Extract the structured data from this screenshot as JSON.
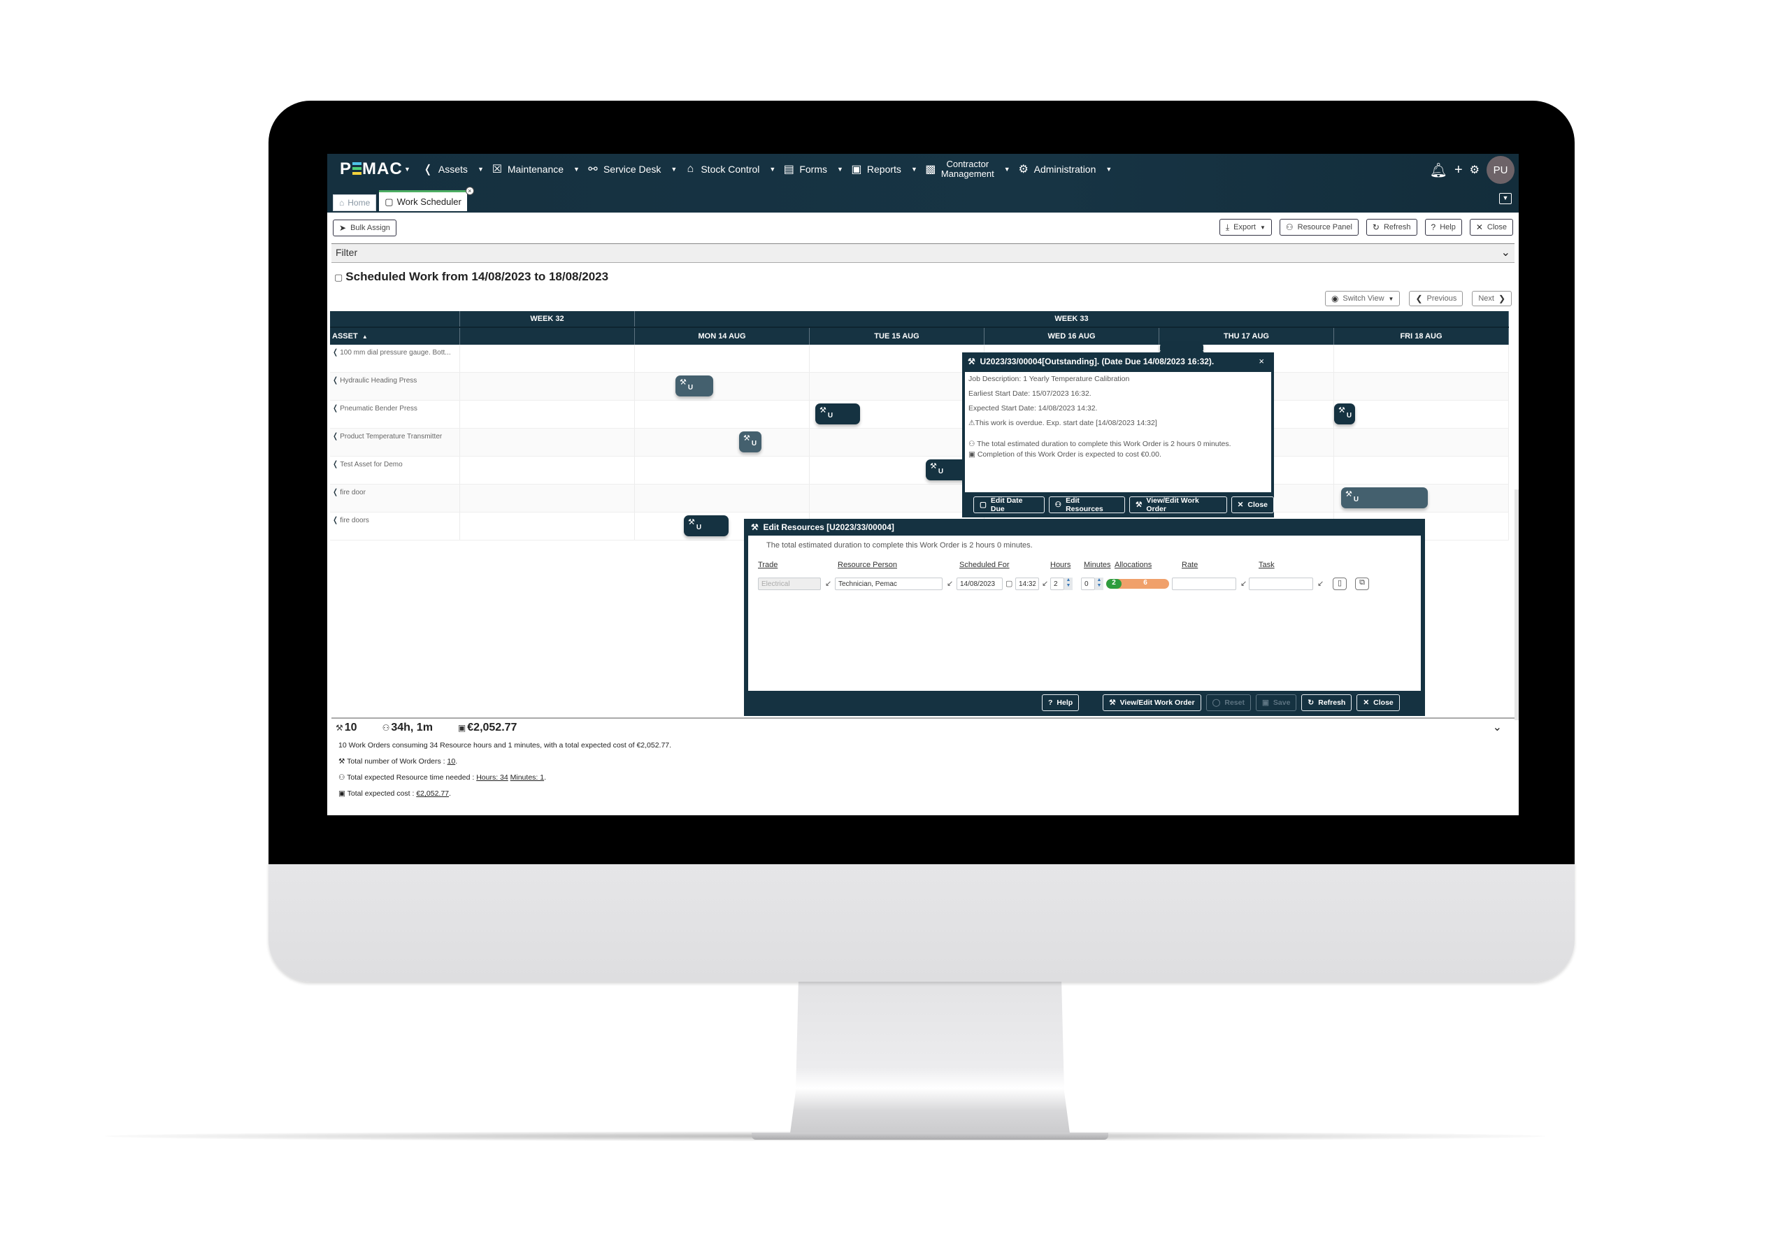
{
  "app": {
    "logo": "PEMAC",
    "nav": [
      {
        "icon": "robot-arm-icon",
        "glyph": "⚔",
        "label": "Assets"
      },
      {
        "icon": "maintenance-icon",
        "glyph": "☒",
        "label": "Maintenance"
      },
      {
        "icon": "service-desk-icon",
        "glyph": "☎",
        "label": "Service Desk"
      },
      {
        "icon": "warehouse-icon",
        "glyph": "⌂",
        "label": "Stock Control"
      },
      {
        "icon": "forms-icon",
        "glyph": "☰",
        "label": "Forms"
      },
      {
        "icon": "reports-icon",
        "glyph": "▤",
        "label": "Reports"
      },
      {
        "icon": "contractor-icon",
        "glyph": "☖",
        "label_line1": "Contractor",
        "label_line2": "Management"
      },
      {
        "icon": "admin-icon",
        "glyph": "⚙",
        "label": "Administration"
      }
    ],
    "user_initials": "PU",
    "tabs": {
      "home": "Home",
      "active": "Work Scheduler"
    }
  },
  "toolbar": {
    "bulk_assign": "Bulk Assign",
    "export": "Export",
    "resource_panel": "Resource Panel",
    "refresh": "Refresh",
    "help": "Help",
    "close": "Close"
  },
  "filter": {
    "label": "Filter"
  },
  "schedule": {
    "title": "Scheduled Work from 14/08/2023 to 18/08/2023",
    "switch_view": "Switch View",
    "previous": "Previous",
    "next": "Next",
    "weeks": [
      "WEEK 32",
      "WEEK 33"
    ],
    "asset_header": "ASSET",
    "days": [
      "MON 14 AUG",
      "TUE 15 AUG",
      "WED 16 AUG",
      "THU 17 AUG",
      "FRI 18 AUG"
    ],
    "assets": [
      "100 mm dial pressure gauge. Bott...",
      "Hydraulic Heading Press",
      "Pneumatic Bender Press",
      "Product Temperature Transmitter",
      "Test Asset for Demo",
      "fire door",
      "fire doors"
    ],
    "work_order_tag": "U"
  },
  "popup": {
    "title": "U2023/33/00004[Outstanding]. (Date Due 14/08/2023 16:32).",
    "job_description": "Job Description: 1 Yearly Temperature Calibration",
    "earliest_start": "Earliest Start Date: 15/07/2023 16:32.",
    "expected_start": "Expected Start Date: 14/08/2023 14:32.",
    "overdue": "This work is overdue. Exp. start date [14/08/2023 14:32]",
    "duration": "The total estimated duration to complete this Work Order is 2 hours 0 minutes.",
    "cost": "Completion of this Work Order is expected to cost €0.00.",
    "buttons": {
      "edit_date_due": "Edit Date Due",
      "edit_resources": "Edit Resources",
      "view_edit": "View/Edit Work Order",
      "close": "Close"
    }
  },
  "edit_resources": {
    "title": "Edit Resources [U2023/33/00004]",
    "intro": "The total estimated duration to complete this Work Order is 2 hours 0 minutes.",
    "columns": {
      "trade": "Trade",
      "resource_person": "Resource Person",
      "scheduled_for": "Scheduled For",
      "hours": "Hours",
      "minutes": "Minutes",
      "allocations": "Allocations",
      "rate": "Rate",
      "task": "Task"
    },
    "row": {
      "trade": "Electrical",
      "resource_person": "Technician, Pemac",
      "date": "14/08/2023",
      "time": "14:32",
      "hours": "2",
      "minutes": "0",
      "alloc_green": "2",
      "alloc_orange": "6",
      "rate": "",
      "task": ""
    },
    "buttons": {
      "help": "Help",
      "view_edit": "View/Edit Work Order",
      "reset": "Reset",
      "save": "Save",
      "refresh": "Refresh",
      "close": "Close"
    }
  },
  "summary": {
    "count": "10",
    "hours": "34h, 1m",
    "cost": "€2,052.77",
    "sentence": "10 Work Orders consuming 34 Resource hours and 1 minutes, with a total expected cost of €2,052.77.",
    "total_wo_label": "Total number of Work Orders :",
    "total_wo_value": "10",
    "resource_time_label": "Total expected Resource time needed :",
    "resource_hours": "Hours: 34",
    "resource_minutes": "Minutes: 1",
    "cost_label": "Total expected cost :",
    "cost_value": "€2,052.77"
  },
  "colors": {
    "nav_bg": "#163342",
    "active_tab_accent": "#4cad62",
    "wo_dark": "#153241",
    "wo_slate": "#44606e",
    "alloc_green": "#2e9c3e",
    "alloc_orange": "#f0a06a"
  }
}
